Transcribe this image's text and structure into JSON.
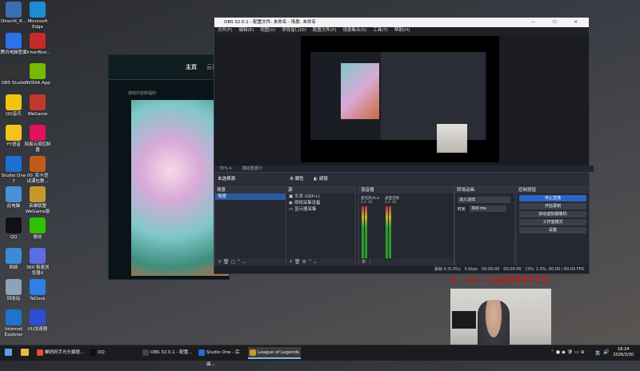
{
  "desktop_icons": [
    {
      "label": "DirectX_R...",
      "color": "#3a6fb5"
    },
    {
      "label": "Microsoft\nEdge",
      "color": "#1e8bd6"
    },
    {
      "label": "腾讯电脑管家",
      "color": "#2e72e6"
    },
    {
      "label": "DriverBoo...",
      "color": "#c62b2b"
    },
    {
      "label": "OBS Studio",
      "color": "#333"
    },
    {
      "label": "NVIDIA App",
      "color": "#76b900"
    },
    {
      "label": "QQ音乐",
      "color": "#f1c40f"
    },
    {
      "label": "WeGame",
      "color": "#c0392b"
    },
    {
      "label": "YY语音",
      "color": "#f5c21b"
    },
    {
      "label": "网易云按控制\n器",
      "color": "#e0115f"
    },
    {
      "label": "Studio One\n7",
      "color": "#1e6ed6"
    },
    {
      "label": "00_库卡语\n试课包教...",
      "color": "#c25a1a"
    },
    {
      "label": "此电脑",
      "color": "#4a90d9"
    },
    {
      "label": "英雄联盟\nWeGame版",
      "color": "#c49a2c"
    },
    {
      "label": "QQ",
      "color": "#111"
    },
    {
      "label": "微信",
      "color": "#2dc100"
    },
    {
      "label": "网络",
      "color": "#3b8bd8"
    },
    {
      "label": "360 极速浏\n览器X",
      "color": "#5b6ee1"
    },
    {
      "label": "回收站",
      "color": "#8fa3b8"
    },
    {
      "label": "ToDesk",
      "color": "#2f7fe8"
    },
    {
      "label": "Internet\nExplorer",
      "color": "#1e74c8"
    },
    {
      "label": "UU加速器",
      "color": "#2a4fd0"
    }
  ],
  "game_window": {
    "tab_home": "主页",
    "tab_cloud": "云顶",
    "banner": "游戏内容和福利"
  },
  "obs": {
    "title": "OBS 32.0.1 - 配置文件: 未命名 - 场景: 未命名",
    "menu": [
      "文件(F)",
      "编辑(E)",
      "视图(V)",
      "停靠窗口(D)",
      "配置文件(P)",
      "场景集合(S)",
      "工具(T)",
      "帮助(H)"
    ],
    "status_row": "模拟重置计",
    "no_source": "未选择源",
    "properties": "属性",
    "filters": "滤镜",
    "docks": {
      "scenes": {
        "title": "场景",
        "items": [
          "场景"
        ]
      },
      "sources": {
        "title": "源",
        "items": [
          "文本 (GDI+)",
          "视频采集设备",
          "显示器采集"
        ]
      },
      "mixer": {
        "title": "混音器",
        "channels": [
          "麦克风/Aux",
          "桌面音频"
        ],
        "level": "0.0 dB"
      },
      "transitions": {
        "title": "转场动画",
        "type": "淡入淡出",
        "duration_label": "时长",
        "duration": "300 ms"
      },
      "controls": {
        "title": "控制按钮",
        "buttons": [
          "停止直播",
          "开始录制",
          "启动虚拟摄像机",
          "工作室模式",
          "设置"
        ]
      }
    },
    "bottom": {
      "dropped": "丢帧 0 (0.0%)",
      "kbps": "0 kbps",
      "live": "00:00:00",
      "rec": "00:00:00",
      "cpu": "CPU: 1.0%, 60.00 / 60.00 FPS"
    }
  },
  "stream_overlay_text": "1--9--ued996729",
  "taskbar": {
    "items": [
      {
        "label": "蝉妈妈手光头摄题...",
        "color": "#e84b3c"
      },
      {
        "label": "QQ",
        "color": "#111"
      },
      {
        "label": "OBS 32.0.1 - 配置...",
        "color": "#444"
      },
      {
        "label": "Studio One - 后曲...",
        "color": "#1e6ed6"
      },
      {
        "label": "League of Legends",
        "color": "#c49a2c"
      }
    ],
    "ime": "英",
    "time": "18:24",
    "date": "2026/3/30"
  }
}
